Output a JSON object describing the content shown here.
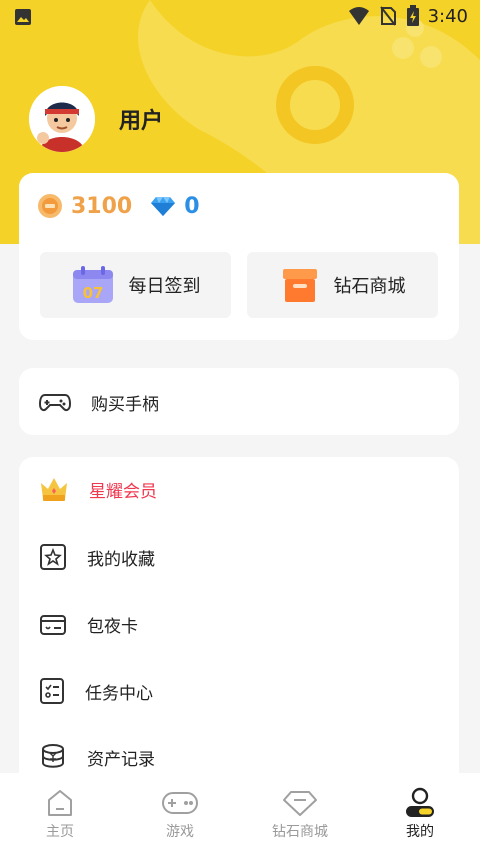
{
  "status_bar": {
    "time": "3:40"
  },
  "profile": {
    "username": "用户"
  },
  "wallet": {
    "coins": "3100",
    "diamonds": "0"
  },
  "actions": {
    "checkin_label": "每日签到",
    "checkin_day": "07",
    "store_label": "钻石商城"
  },
  "buy_controller": {
    "label": "购买手柄"
  },
  "menu": {
    "items": [
      {
        "label": "星耀会员",
        "icon": "crown-icon"
      },
      {
        "label": "我的收藏",
        "icon": "star-icon"
      },
      {
        "label": "包夜卡",
        "icon": "card-icon"
      },
      {
        "label": "任务中心",
        "icon": "task-list-icon"
      },
      {
        "label": "资产记录",
        "icon": "coin-stack-icon"
      }
    ]
  },
  "tabbar": {
    "tabs": [
      {
        "label": "主页",
        "icon": "home-icon"
      },
      {
        "label": "游戏",
        "icon": "gamepad-icon"
      },
      {
        "label": "钻石商城",
        "icon": "diamond-icon"
      },
      {
        "label": "我的",
        "icon": "profile-icon"
      }
    ],
    "active": "我的"
  },
  "colors": {
    "header": "#f5d227",
    "vip": "#f0384f",
    "coin": "#f0a24a",
    "diamond": "#2b8fe6"
  }
}
